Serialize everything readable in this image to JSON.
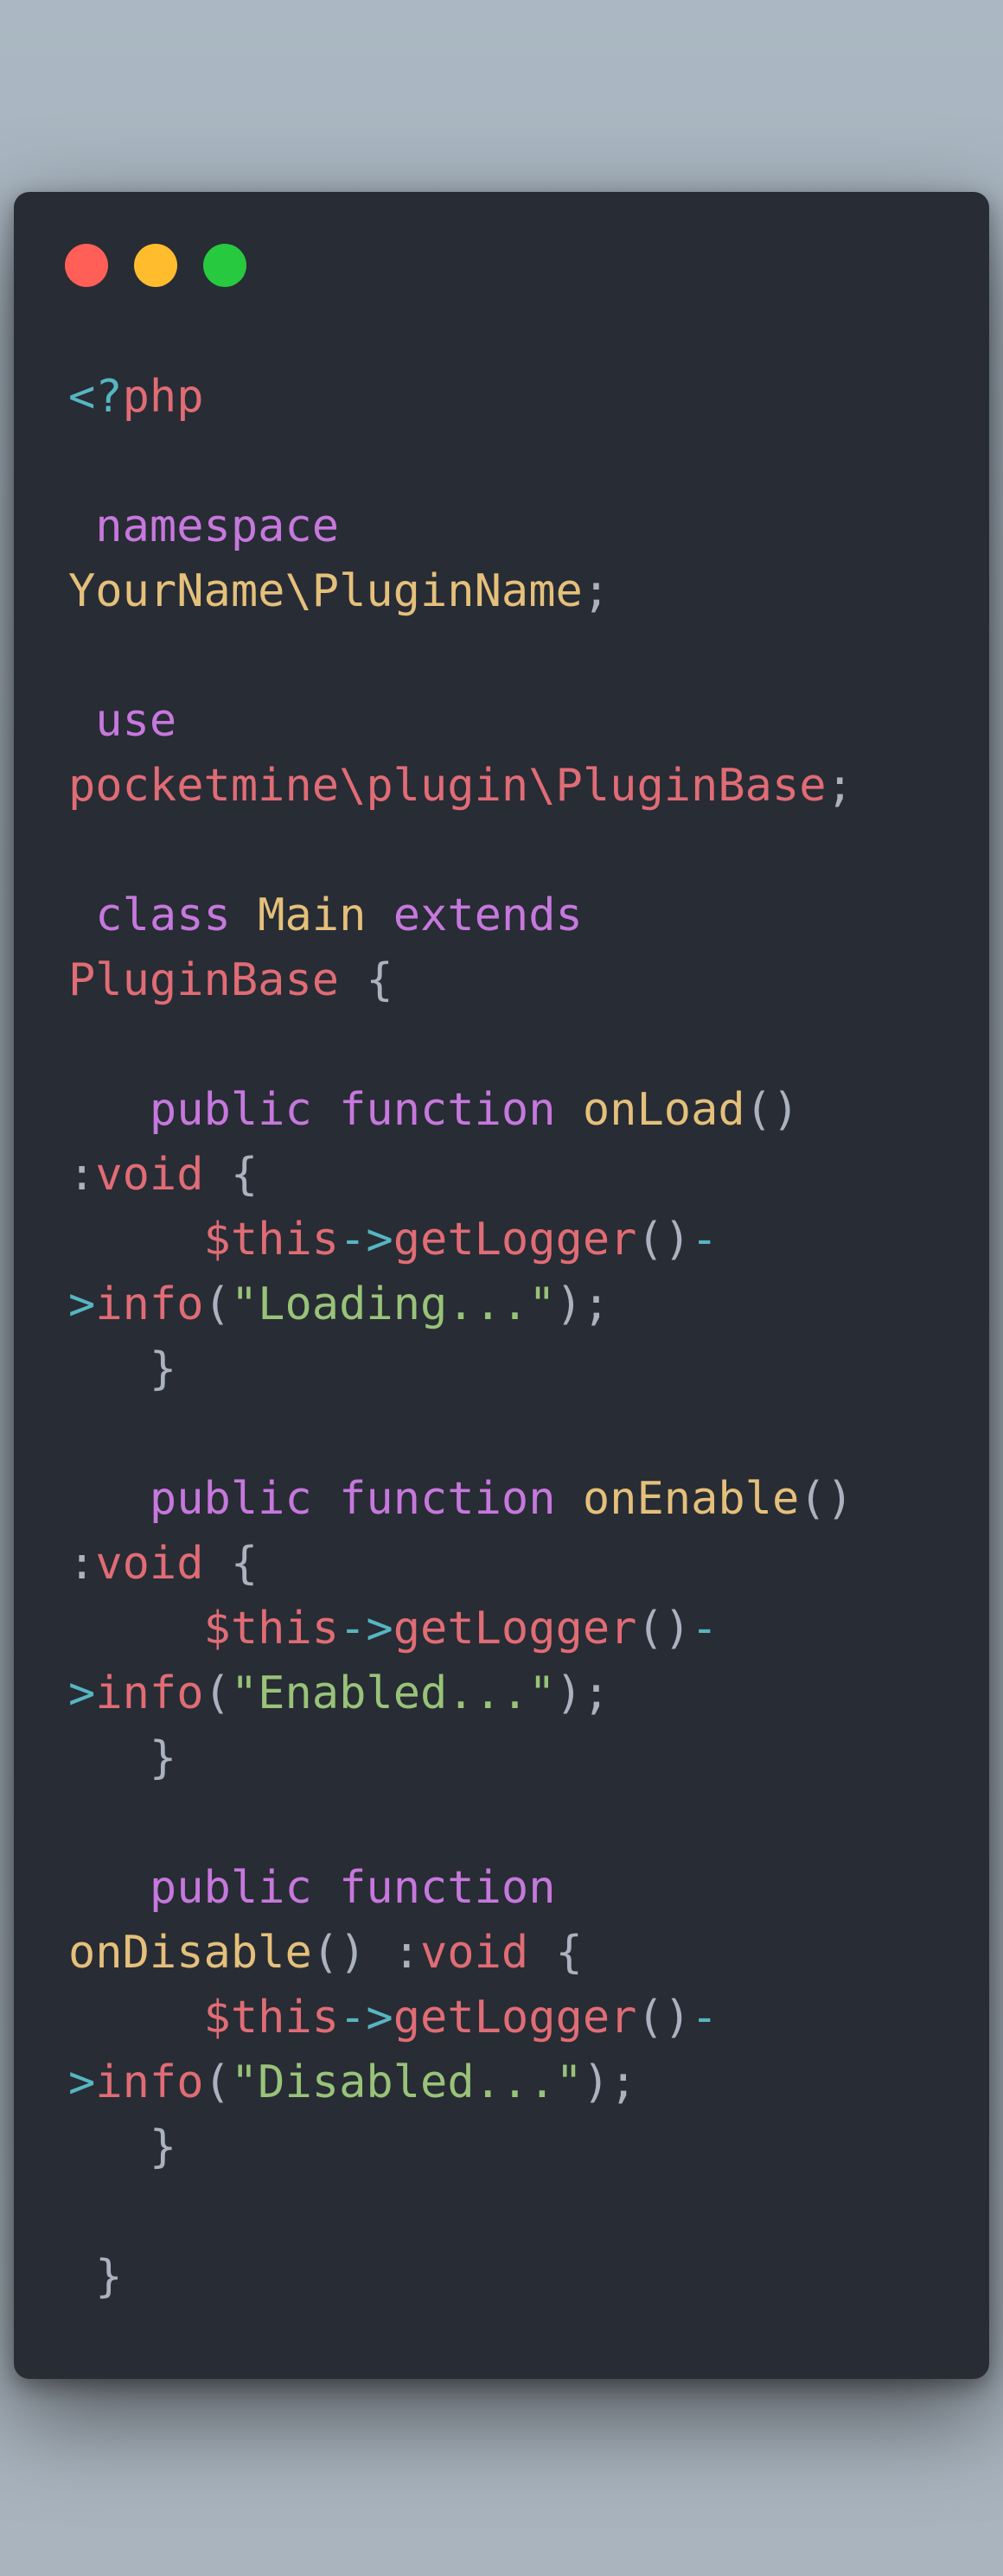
{
  "window": {
    "controls": [
      {
        "name": "close",
        "color": "#ff5f56"
      },
      {
        "name": "minimize",
        "color": "#ffbd2e"
      },
      {
        "name": "maximize",
        "color": "#27c93f"
      }
    ]
  },
  "theme": {
    "background": "#282c34",
    "plain": "#abb2bf",
    "keyword": "#c678dd",
    "name": "#e5c07b",
    "variable": "#e06c75",
    "operator": "#56b6c2",
    "string": "#98c379"
  },
  "code": {
    "lines": [
      [
        {
          "t": "<?",
          "c": "operator"
        },
        {
          "t": "php",
          "c": "variable"
        }
      ],
      [],
      [
        {
          "t": " namespace",
          "c": "keyword"
        }
      ],
      [
        {
          "t": "YourName\\PluginName",
          "c": "name"
        },
        {
          "t": ";",
          "c": "plain"
        }
      ],
      [],
      [
        {
          "t": " use",
          "c": "keyword"
        }
      ],
      [
        {
          "t": "pocketmine\\plugin\\PluginBase",
          "c": "variable"
        },
        {
          "t": ";",
          "c": "plain"
        }
      ],
      [],
      [
        {
          "t": " class",
          "c": "keyword"
        },
        {
          "t": " ",
          "c": "plain"
        },
        {
          "t": "Main",
          "c": "name"
        },
        {
          "t": " ",
          "c": "plain"
        },
        {
          "t": "extends",
          "c": "keyword"
        }
      ],
      [
        {
          "t": "PluginBase",
          "c": "variable"
        },
        {
          "t": " {",
          "c": "plain"
        }
      ],
      [],
      [
        {
          "t": "   public",
          "c": "keyword"
        },
        {
          "t": " ",
          "c": "plain"
        },
        {
          "t": "function",
          "c": "keyword"
        },
        {
          "t": " ",
          "c": "plain"
        },
        {
          "t": "onLoad",
          "c": "name"
        },
        {
          "t": "()",
          "c": "plain"
        }
      ],
      [
        {
          "t": ":",
          "c": "plain"
        },
        {
          "t": "void",
          "c": "variable"
        },
        {
          "t": " {",
          "c": "plain"
        }
      ],
      [
        {
          "t": "     $this",
          "c": "variable"
        },
        {
          "t": "->",
          "c": "operator"
        },
        {
          "t": "getLogger",
          "c": "variable"
        },
        {
          "t": "()",
          "c": "plain"
        },
        {
          "t": "-",
          "c": "operator"
        }
      ],
      [
        {
          "t": ">",
          "c": "operator"
        },
        {
          "t": "info",
          "c": "variable"
        },
        {
          "t": "(",
          "c": "plain"
        },
        {
          "t": "\"Loading...\"",
          "c": "string"
        },
        {
          "t": ");",
          "c": "plain"
        }
      ],
      [
        {
          "t": "   }",
          "c": "plain"
        }
      ],
      [],
      [
        {
          "t": "   public",
          "c": "keyword"
        },
        {
          "t": " ",
          "c": "plain"
        },
        {
          "t": "function",
          "c": "keyword"
        },
        {
          "t": " ",
          "c": "plain"
        },
        {
          "t": "onEnable",
          "c": "name"
        },
        {
          "t": "()",
          "c": "plain"
        }
      ],
      [
        {
          "t": ":",
          "c": "plain"
        },
        {
          "t": "void",
          "c": "variable"
        },
        {
          "t": " {",
          "c": "plain"
        }
      ],
      [
        {
          "t": "     $this",
          "c": "variable"
        },
        {
          "t": "->",
          "c": "operator"
        },
        {
          "t": "getLogger",
          "c": "variable"
        },
        {
          "t": "()",
          "c": "plain"
        },
        {
          "t": "-",
          "c": "operator"
        }
      ],
      [
        {
          "t": ">",
          "c": "operator"
        },
        {
          "t": "info",
          "c": "variable"
        },
        {
          "t": "(",
          "c": "plain"
        },
        {
          "t": "\"Enabled...\"",
          "c": "string"
        },
        {
          "t": ");",
          "c": "plain"
        }
      ],
      [
        {
          "t": "   }",
          "c": "plain"
        }
      ],
      [],
      [
        {
          "t": "   public",
          "c": "keyword"
        },
        {
          "t": " ",
          "c": "plain"
        },
        {
          "t": "function",
          "c": "keyword"
        }
      ],
      [
        {
          "t": "onDisable",
          "c": "name"
        },
        {
          "t": "() :",
          "c": "plain"
        },
        {
          "t": "void",
          "c": "variable"
        },
        {
          "t": " {",
          "c": "plain"
        }
      ],
      [
        {
          "t": "     $this",
          "c": "variable"
        },
        {
          "t": "->",
          "c": "operator"
        },
        {
          "t": "getLogger",
          "c": "variable"
        },
        {
          "t": "()",
          "c": "plain"
        },
        {
          "t": "-",
          "c": "operator"
        }
      ],
      [
        {
          "t": ">",
          "c": "operator"
        },
        {
          "t": "info",
          "c": "variable"
        },
        {
          "t": "(",
          "c": "plain"
        },
        {
          "t": "\"Disabled...\"",
          "c": "string"
        },
        {
          "t": ");",
          "c": "plain"
        }
      ],
      [
        {
          "t": "   }",
          "c": "plain"
        }
      ],
      [],
      [
        {
          "t": " }",
          "c": "plain"
        }
      ]
    ]
  }
}
